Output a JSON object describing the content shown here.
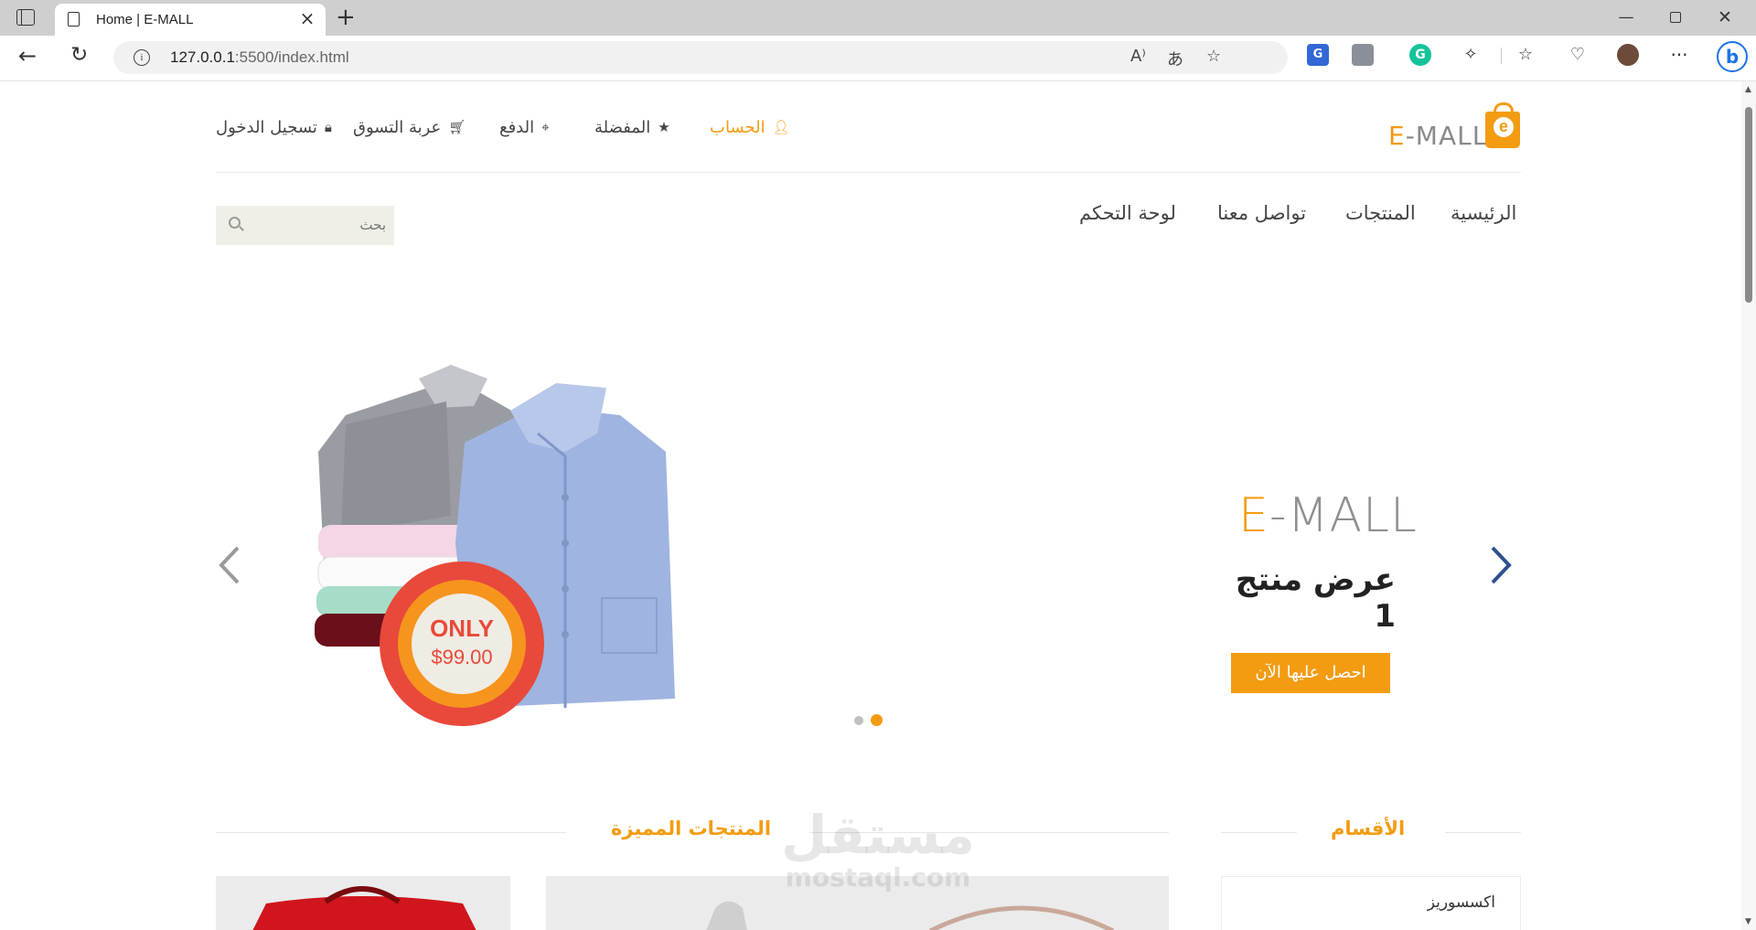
{
  "browser": {
    "tab_title": "Home | E-MALL",
    "url_host": "127.0.0.1",
    "url_path": ":5500/index.html"
  },
  "site": {
    "logo_prefix": "E",
    "logo_suffix": "-MALL",
    "logo_bag_letter": "e"
  },
  "topnav": {
    "account": "الحساب",
    "wishlist": "المفضلة",
    "checkout": "الدفع",
    "cart": "عربة التسوق",
    "login": "تسجيل الدخول"
  },
  "mainnav": {
    "home": "الرئيسية",
    "products": "المنتجات",
    "contact": "تواصل معنا",
    "dashboard": "لوحة التحكم"
  },
  "search": {
    "placeholder": "بحث"
  },
  "slider": {
    "brand_prefix": "E",
    "brand_suffix": "-MALL",
    "title": "عرض منتج 1",
    "cta": "احصل عليها الآن",
    "badge_line1": "ONLY",
    "badge_line2": "$99.00",
    "active_slide": 2,
    "slide_count": 2
  },
  "sections": {
    "featured": "المنتجات المميزة",
    "categories": "الأقسام"
  },
  "categories": [
    "اكسسوريز"
  ],
  "watermark": {
    "arabic": "مستقل",
    "latin": "mostaql.com"
  },
  "colors": {
    "accent": "#f39c12",
    "text": "#444444",
    "arrow_active": "#2f4f8f"
  }
}
